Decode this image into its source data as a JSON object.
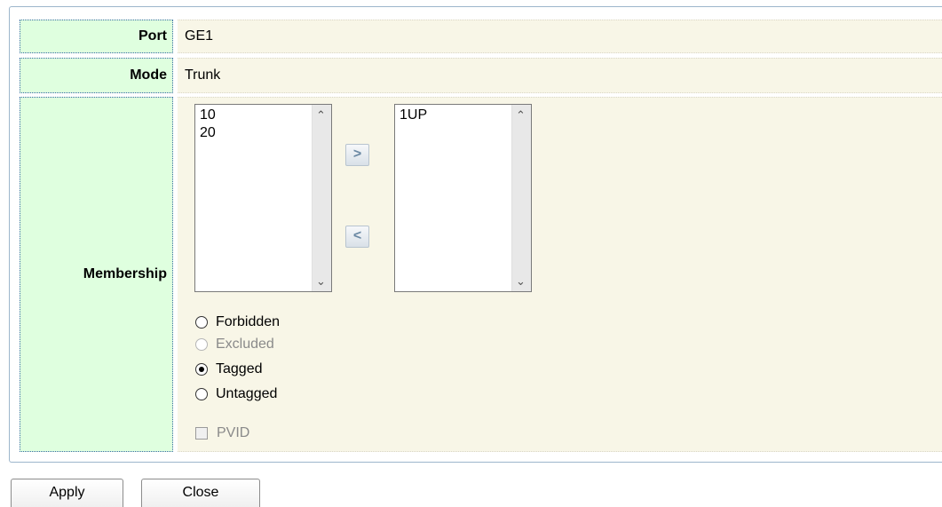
{
  "rows": {
    "port": {
      "label": "Port",
      "value": "GE1"
    },
    "mode": {
      "label": "Mode",
      "value": "Trunk"
    },
    "membership": {
      "label": "Membership"
    }
  },
  "lists": {
    "available": [
      "10",
      "20"
    ],
    "selected": [
      "1UP"
    ]
  },
  "move_buttons": {
    "add": ">",
    "remove": "<"
  },
  "radios": [
    {
      "label": "Forbidden",
      "checked": false,
      "disabled": false
    },
    {
      "label": "Excluded",
      "checked": false,
      "disabled": true
    },
    {
      "label": "Tagged",
      "checked": true,
      "disabled": false
    },
    {
      "label": "Untagged",
      "checked": false,
      "disabled": false
    }
  ],
  "pvid": {
    "label": "PVID",
    "checked": false,
    "disabled": true
  },
  "buttons": {
    "apply": "Apply",
    "close": "Close"
  },
  "colors": {
    "label_bg": "#dfffdf",
    "value_bg": "#f8f6e7",
    "panel_border": "#9db6cc"
  }
}
